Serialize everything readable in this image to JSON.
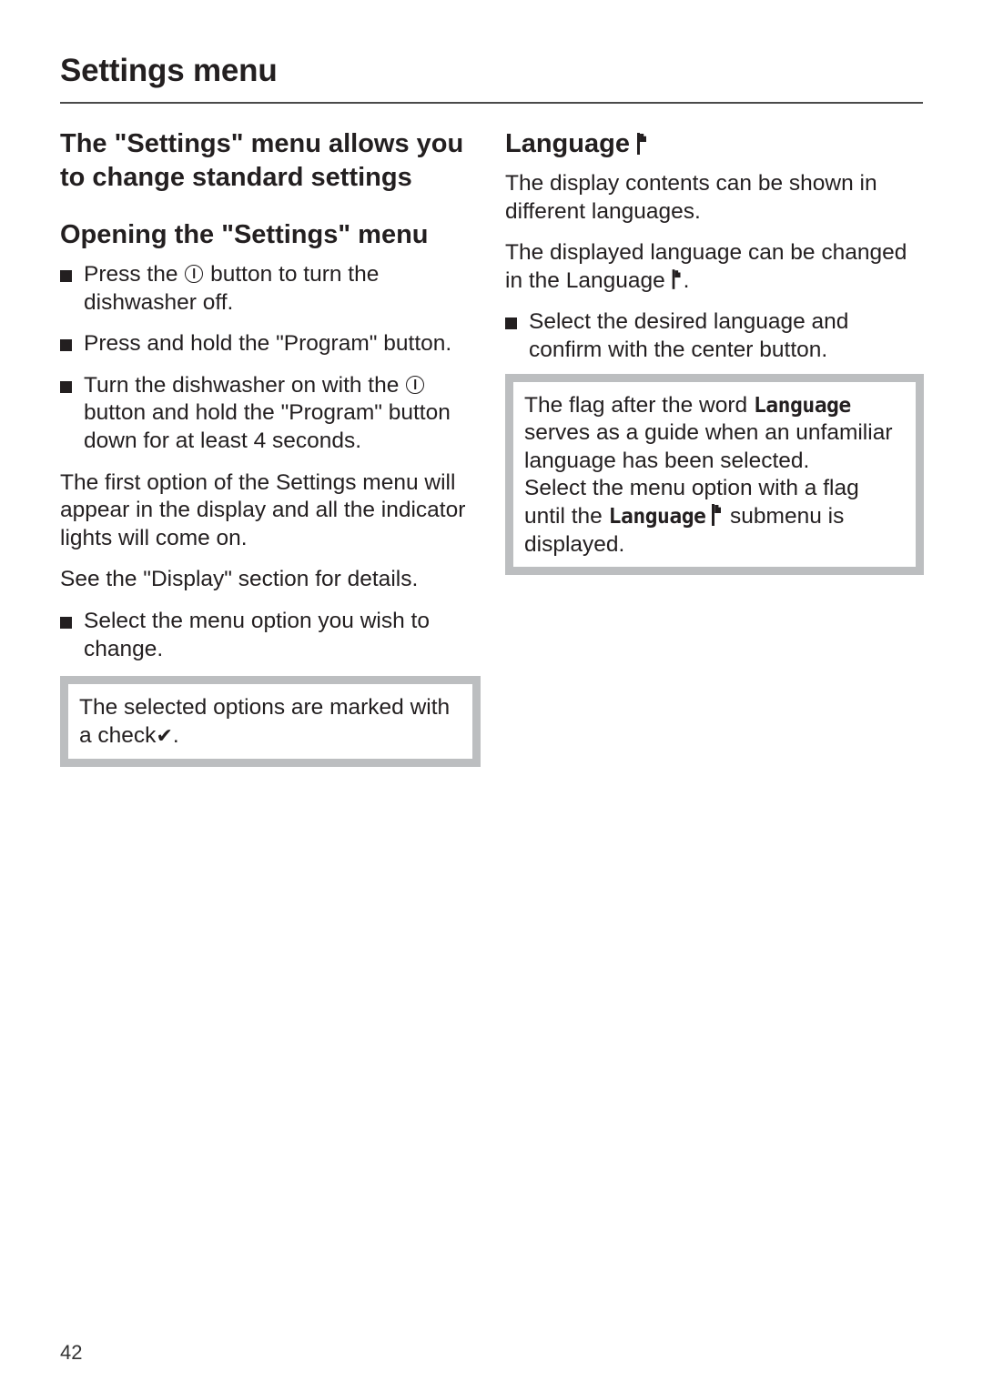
{
  "header": {
    "title": "Settings menu"
  },
  "left_column": {
    "intro_heading": "The \"Settings\" menu allows you to change standard settings",
    "opening_heading": "Opening the \"Settings\" menu",
    "steps": [
      {
        "before": "Press the",
        "icon": "power-icon",
        "after": "button to turn the dishwasher off."
      },
      {
        "text": "Press and hold the \"Program\" button."
      },
      {
        "before": "Turn the dishwasher on with the",
        "icon": "power-icon",
        "after": "button and hold the \"Program\" button down for at least 4 seconds."
      }
    ],
    "para_first_option": "The first option of the Settings menu will appear in the display and all the indicator lights will come on.",
    "para_see_display": "See the \"Display\" section for details.",
    "step_select": "Select the menu option you wish to change.",
    "note": {
      "text": "The selected options are marked with a  check",
      "icon": "check-icon",
      "icon_glyph": "✔",
      "end": "."
    }
  },
  "right_column": {
    "heading": "Language",
    "heading_icon": "flag-icon",
    "para_1": "The display contents can be shown in different languages.",
    "para_2_before": "The displayed language can be changed in the Language",
    "para_2_end": ".",
    "step_select": "Select the desired language and confirm with the center button.",
    "note": {
      "line1_before": "The flag after the word",
      "lcd_word": "Language",
      "line1_after": "serves as a guide when an unfamiliar language has been selected.",
      "line2_before": "Select the menu option with a flag until the",
      "line2_lcd_word": "Language",
      "line2_after": "submenu is displayed."
    }
  },
  "footer": {
    "page_number": "42"
  }
}
